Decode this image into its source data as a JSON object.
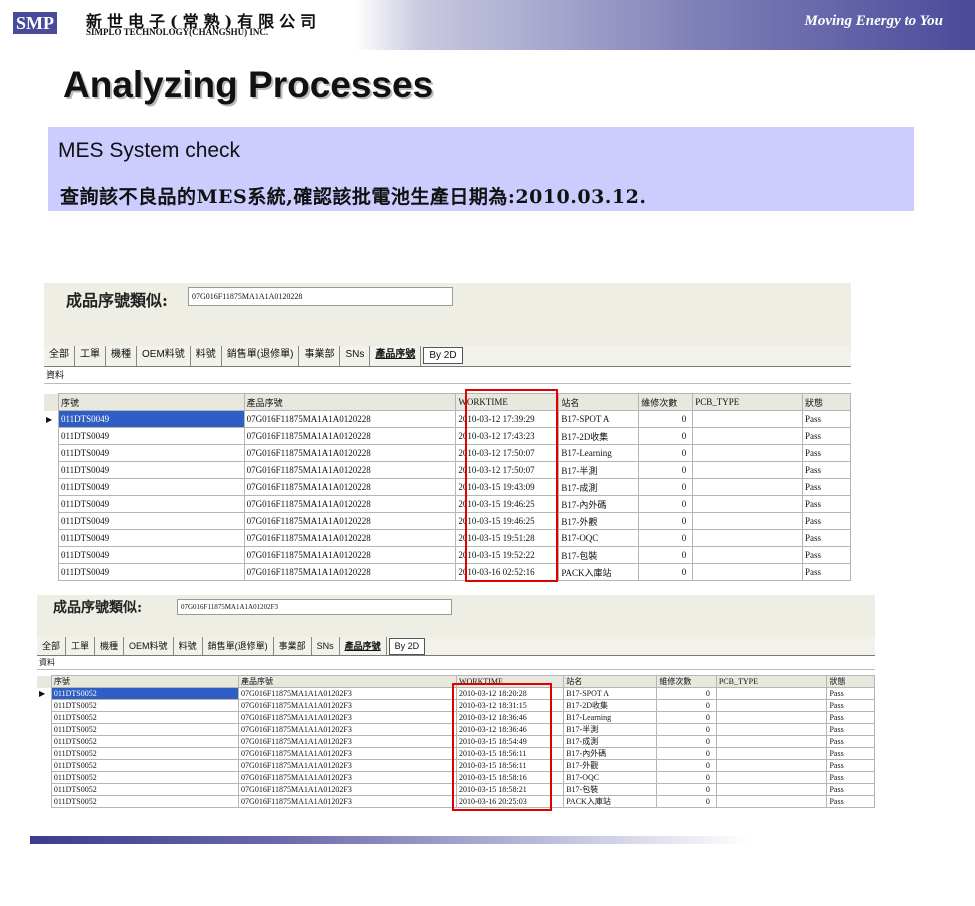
{
  "header": {
    "logo_mark": "SMP",
    "company_cn": "新世电子(常熟)有限公司",
    "company_en": "SIMPLO TECHNOLOGY(CHANGSHU) INC.",
    "tagline": "Moving Energy to You"
  },
  "slide": {
    "title": "Analyzing Processes",
    "band_line1": "MES System check",
    "band_line2": "查詢該不良品的MES系統,確認該批電池生產日期為:2010.03.12."
  },
  "screens": [
    {
      "query_label": "成品序號類似:",
      "query_value": "07G016F11875MA1A1A0120228",
      "tabs": [
        "全部",
        "工單",
        "機種",
        "OEM料號",
        "料號",
        "銷售單(退修單)",
        "事業部",
        "SNs",
        "產品序號",
        "By 2D"
      ],
      "subtab": "資料",
      "columns": [
        "序號",
        "產品序號",
        "WORKTIME",
        "站名",
        "維修次數",
        "PCB_TYPE",
        "狀態"
      ],
      "rows": [
        [
          "011DTS0049",
          "07G016F11875MA1A1A0120228",
          "2010-03-12 17:39:29",
          "B17-SPOT A",
          "0",
          "",
          "Pass"
        ],
        [
          "011DTS0049",
          "07G016F11875MA1A1A0120228",
          "2010-03-12 17:43:23",
          "B17-2D收集",
          "0",
          "",
          "Pass"
        ],
        [
          "011DTS0049",
          "07G016F11875MA1A1A0120228",
          "2010-03-12 17:50:07",
          "B17-Learning",
          "0",
          "",
          "Pass"
        ],
        [
          "011DTS0049",
          "07G016F11875MA1A1A0120228",
          "2010-03-12 17:50:07",
          "B17-半測",
          "0",
          "",
          "Pass"
        ],
        [
          "011DTS0049",
          "07G016F11875MA1A1A0120228",
          "2010-03-15 19:43:09",
          "B17-成測",
          "0",
          "",
          "Pass"
        ],
        [
          "011DTS0049",
          "07G016F11875MA1A1A0120228",
          "2010-03-15 19:46:25",
          "B17-內外碼",
          "0",
          "",
          "Pass"
        ],
        [
          "011DTS0049",
          "07G016F11875MA1A1A0120228",
          "2010-03-15 19:46:25",
          "B17-外觀",
          "0",
          "",
          "Pass"
        ],
        [
          "011DTS0049",
          "07G016F11875MA1A1A0120228",
          "2010-03-15 19:51:28",
          "B17-OQC",
          "0",
          "",
          "Pass"
        ],
        [
          "011DTS0049",
          "07G016F11875MA1A1A0120228",
          "2010-03-15 19:52:22",
          "B17-包裝",
          "0",
          "",
          "Pass"
        ],
        [
          "011DTS0049",
          "07G016F11875MA1A1A0120228",
          "2010-03-16 02:52:16",
          "PACK入庫站",
          "0",
          "",
          "Pass"
        ]
      ]
    },
    {
      "query_label": "成品序號類似:",
      "query_value": "07G016F11875MA1A1A01202F3",
      "tabs": [
        "全部",
        "工單",
        "機種",
        "OEM料號",
        "料號",
        "銷售單(退修單)",
        "事業部",
        "SNs",
        "產品序號",
        "By 2D"
      ],
      "subtab": "資料",
      "columns": [
        "序號",
        "產品序號",
        "WORKTIME",
        "站名",
        "維修次數",
        "PCB_TYPE",
        "狀態"
      ],
      "rows": [
        [
          "011DTS0052",
          "07G016F11875MA1A1A01202F3",
          "2010-03-12 18:20:28",
          "B17-SPOT A",
          "0",
          "",
          "Pass"
        ],
        [
          "011DTS0052",
          "07G016F11875MA1A1A01202F3",
          "2010-03-12 18:31:15",
          "B17-2D收集",
          "0",
          "",
          "Pass"
        ],
        [
          "011DTS0052",
          "07G016F11875MA1A1A01202F3",
          "2010-03-12 18:36:46",
          "B17-Learning",
          "0",
          "",
          "Pass"
        ],
        [
          "011DTS0052",
          "07G016F11875MA1A1A01202F3",
          "2010-03-12 18:36:46",
          "B17-半測",
          "0",
          "",
          "Pass"
        ],
        [
          "011DTS0052",
          "07G016F11875MA1A1A01202F3",
          "2010-03-15 18:54:49",
          "B17-成測",
          "0",
          "",
          "Pass"
        ],
        [
          "011DTS0052",
          "07G016F11875MA1A1A01202F3",
          "2010-03-15 18:56:11",
          "B17-內外碼",
          "0",
          "",
          "Pass"
        ],
        [
          "011DTS0052",
          "07G016F11875MA1A1A01202F3",
          "2010-03-15 18:56:11",
          "B17-外觀",
          "0",
          "",
          "Pass"
        ],
        [
          "011DTS0052",
          "07G016F11875MA1A1A01202F3",
          "2010-03-15 18:58:16",
          "B17-OQC",
          "0",
          "",
          "Pass"
        ],
        [
          "011DTS0052",
          "07G016F11875MA1A1A01202F3",
          "2010-03-15 18:58:21",
          "B17-包裝",
          "0",
          "",
          "Pass"
        ],
        [
          "011DTS0052",
          "07G016F11875MA1A1A01202F3",
          "2010-03-16 20:25:03",
          "PACK入庫站",
          "0",
          "",
          "Pass"
        ]
      ]
    }
  ],
  "colors": {
    "brand": "#4a4a9a",
    "band": "#ccccff",
    "highlight": "#e00000",
    "selected_row": "#2f5fc4"
  }
}
